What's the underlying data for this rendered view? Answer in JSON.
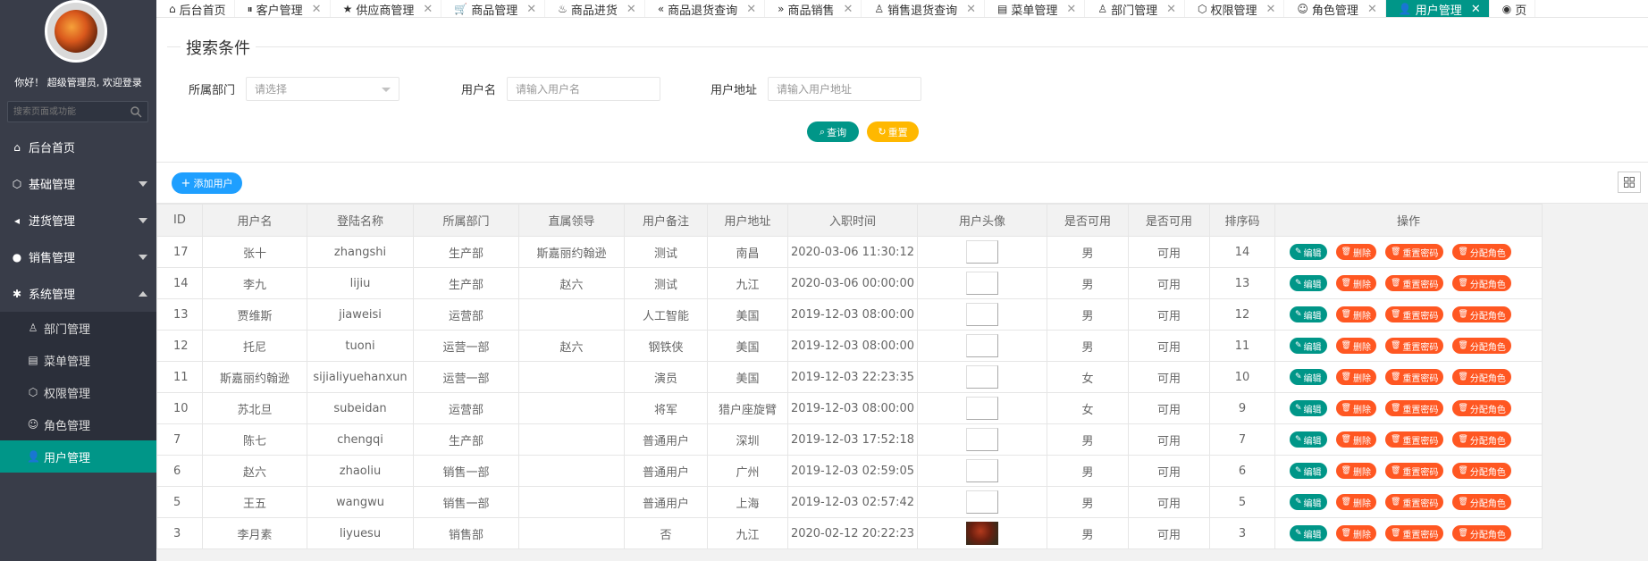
{
  "sidebar": {
    "welcome": "你好！ 超级管理员, 欢迎登录",
    "search_placeholder": "搜索页面或功能",
    "menu": [
      {
        "label": "后台首页",
        "icon": "home-icon"
      },
      {
        "label": "基础管理",
        "icon": "cube-icon"
      },
      {
        "label": "进货管理",
        "icon": "volume-icon"
      },
      {
        "label": "销售管理",
        "icon": "chat-icon"
      },
      {
        "label": "系统管理",
        "icon": "gear-icon"
      }
    ],
    "submenu": [
      {
        "label": "部门管理",
        "icon": "user-outline-icon"
      },
      {
        "label": "菜单管理",
        "icon": "menu-grid-icon"
      },
      {
        "label": "权限管理",
        "icon": "cube-icon"
      },
      {
        "label": "角色管理",
        "icon": "smile-icon"
      },
      {
        "label": "用户管理",
        "icon": "user-icon"
      }
    ]
  },
  "tabs": [
    {
      "label": "后台首页",
      "icon": "home-icon",
      "closable": false
    },
    {
      "label": "客户管理",
      "icon": "pause-circle-icon",
      "closable": true
    },
    {
      "label": "供应商管理",
      "icon": "star-icon",
      "closable": true
    },
    {
      "label": "商品管理",
      "icon": "cart-icon",
      "closable": true
    },
    {
      "label": "商品进货",
      "icon": "fire-icon",
      "closable": true
    },
    {
      "label": "商品退货查询",
      "icon": "double-left-icon",
      "closable": true
    },
    {
      "label": "商品销售",
      "icon": "double-right-icon",
      "closable": true
    },
    {
      "label": "销售退货查询",
      "icon": "user-outline-icon",
      "closable": true
    },
    {
      "label": "菜单管理",
      "icon": "menu-grid-icon",
      "closable": true
    },
    {
      "label": "部门管理",
      "icon": "user-outline-icon",
      "closable": true
    },
    {
      "label": "权限管理",
      "icon": "cube-icon",
      "closable": true
    },
    {
      "label": "角色管理",
      "icon": "smile-icon",
      "closable": true
    },
    {
      "label": "用户管理",
      "icon": "user-icon",
      "closable": true,
      "active": true
    },
    {
      "label": "页",
      "icon": "target-icon",
      "closable": false
    }
  ],
  "search": {
    "legend": "搜索条件",
    "dept_label": "所属部门",
    "dept_placeholder": "请选择",
    "username_label": "用户名",
    "username_placeholder": "请输入用户名",
    "address_label": "用户地址",
    "address_placeholder": "请输入用户地址",
    "query_label": "查询",
    "reset_label": "重置"
  },
  "toolbar": {
    "add_label": "添加用户"
  },
  "table": {
    "headers": [
      "ID",
      "用户名",
      "登陆名称",
      "所属部门",
      "直属领导",
      "用户备注",
      "用户地址",
      "入职时间",
      "用户头像",
      "是否可用",
      "是否可用",
      "排序码",
      "操作"
    ],
    "ops": {
      "edit": "编辑",
      "del": "删除",
      "reset": "重置密码",
      "role": "分配角色"
    },
    "rows": [
      {
        "id": "17",
        "name": "张十",
        "login": "zhangshi",
        "dept": "生产部",
        "leader": "斯嘉丽约翰逊",
        "remark": "测试",
        "address": "南昌",
        "time": "2020-03-06 11:30:12",
        "avatar": "broken",
        "sex": "男",
        "avail": "可用",
        "order": "14"
      },
      {
        "id": "14",
        "name": "李九",
        "login": "lijiu",
        "dept": "生产部",
        "leader": "赵六",
        "remark": "测试",
        "address": "九江",
        "time": "2020-03-06 00:00:00",
        "avatar": "broken",
        "sex": "男",
        "avail": "可用",
        "order": "13"
      },
      {
        "id": "13",
        "name": "贾维斯",
        "login": "jiaweisi",
        "dept": "运营部",
        "leader": "",
        "remark": "人工智能",
        "address": "美国",
        "time": "2019-12-03 08:00:00",
        "avatar": "broken",
        "sex": "男",
        "avail": "可用",
        "order": "12"
      },
      {
        "id": "12",
        "name": "托尼",
        "login": "tuoni",
        "dept": "运营一部",
        "leader": "赵六",
        "remark": "钢铁侠",
        "address": "美国",
        "time": "2019-12-03 08:00:00",
        "avatar": "broken",
        "sex": "男",
        "avail": "可用",
        "order": "11"
      },
      {
        "id": "11",
        "name": "斯嘉丽约翰逊",
        "login": "sijialiyuehanxun",
        "dept": "运营一部",
        "leader": "",
        "remark": "演员",
        "address": "美国",
        "time": "2019-12-03 22:23:35",
        "avatar": "broken",
        "sex": "女",
        "avail": "可用",
        "order": "10"
      },
      {
        "id": "10",
        "name": "苏北旦",
        "login": "subeidan",
        "dept": "运营部",
        "leader": "",
        "remark": "将军",
        "address": "猎户座旋臂",
        "time": "2019-12-03 08:00:00",
        "avatar": "broken",
        "sex": "女",
        "avail": "可用",
        "order": "9"
      },
      {
        "id": "7",
        "name": "陈七",
        "login": "chengqi",
        "dept": "生产部",
        "leader": "",
        "remark": "普通用户",
        "address": "深圳",
        "time": "2019-12-03 17:52:18",
        "avatar": "broken",
        "sex": "男",
        "avail": "可用",
        "order": "7"
      },
      {
        "id": "6",
        "name": "赵六",
        "login": "zhaoliu",
        "dept": "销售一部",
        "leader": "",
        "remark": "普通用户",
        "address": "广州",
        "time": "2019-12-03 02:59:05",
        "avatar": "broken",
        "sex": "男",
        "avail": "可用",
        "order": "6"
      },
      {
        "id": "5",
        "name": "王五",
        "login": "wangwu",
        "dept": "销售一部",
        "leader": "",
        "remark": "普通用户",
        "address": "上海",
        "time": "2019-12-03 02:57:42",
        "avatar": "broken",
        "sex": "男",
        "avail": "可用",
        "order": "5"
      },
      {
        "id": "3",
        "name": "李月素",
        "login": "liyuesu",
        "dept": "销售部",
        "leader": "",
        "remark": "否",
        "address": "九江",
        "time": "2020-02-12 20:22:23",
        "avatar": "photo",
        "sex": "男",
        "avail": "可用",
        "order": "3"
      }
    ]
  },
  "colors": {
    "sidebar_bg": "#393d49",
    "accent": "#009688",
    "warn": "#ffb800",
    "danger": "#ff5722",
    "primary": "#1e9fff"
  }
}
